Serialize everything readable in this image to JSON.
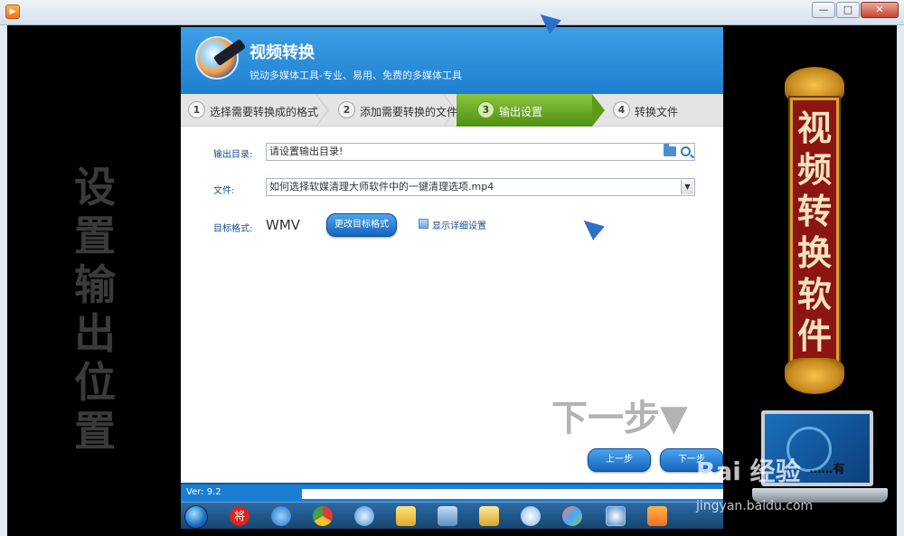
{
  "player": {
    "minimize": "—",
    "maximize": "□",
    "close": "✕"
  },
  "side_caption": "设置输出位置",
  "banner": {
    "text": "视频转换软件"
  },
  "laptop": {
    "label": "……有"
  },
  "app": {
    "title": "视频转换",
    "subtitle": "锐动多媒体工具-专业、易用、免费的多媒体工具",
    "steps": [
      {
        "num": "1",
        "label": "选择需要转换成的格式"
      },
      {
        "num": "2",
        "label": "添加需要转换的文件"
      },
      {
        "num": "3",
        "label": "输出设置"
      },
      {
        "num": "4",
        "label": "转换文件"
      }
    ],
    "active_step_color": "#5a9c17",
    "output_dir": {
      "label": "输出目录:",
      "value": "请设置输出目录!"
    },
    "file": {
      "label": "文件:",
      "value": "如何选择软媒清理大师软件中的一键清理选项.mp4"
    },
    "target_format": {
      "label": "目标格式:",
      "value": "WMV",
      "change_button": "更改目标格式",
      "detail_checkbox_label": "显示详细设置"
    },
    "overlay_hint": "下一步▼",
    "prev_button": "上一步",
    "next_button": "下一步",
    "version": "Ver: 9.2"
  },
  "taskbar": {
    "items": [
      "start-orb",
      "将",
      "ie",
      "chrome",
      "app",
      "folder",
      "network",
      "explorer",
      "app2",
      "paint",
      "media",
      "player"
    ]
  },
  "watermark": {
    "brand": "Bai 经验",
    "url": "jingyan.baidu.com"
  }
}
